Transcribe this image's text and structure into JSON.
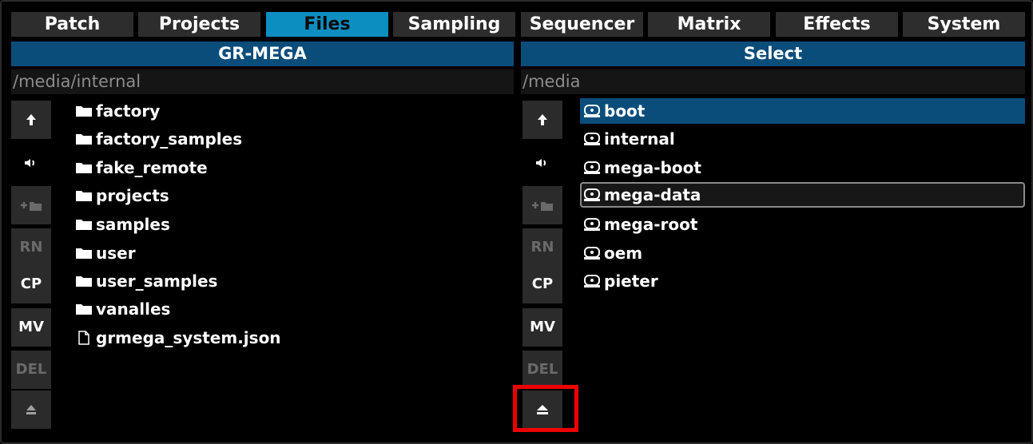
{
  "tabs": [
    {
      "label": "Patch"
    },
    {
      "label": "Projects"
    },
    {
      "label": "Files"
    },
    {
      "label": "Sampling"
    },
    {
      "label": "Sequencer"
    },
    {
      "label": "Matrix"
    },
    {
      "label": "Effects"
    },
    {
      "label": "System"
    }
  ],
  "active_tab": "Files",
  "left": {
    "header": "GR-MEGA",
    "path": "/media/internal",
    "items": [
      {
        "label": "factory",
        "icon": "folder-icon"
      },
      {
        "label": "factory_samples",
        "icon": "folder-icon"
      },
      {
        "label": "fake_remote",
        "icon": "folder-icon"
      },
      {
        "label": "projects",
        "icon": "folder-icon"
      },
      {
        "label": "samples",
        "icon": "folder-icon"
      },
      {
        "label": "user",
        "icon": "folder-icon"
      },
      {
        "label": "user_samples",
        "icon": "folder-icon"
      },
      {
        "label": "vanalles",
        "icon": "folder-icon"
      },
      {
        "label": "grmega_system.json",
        "icon": "file-icon"
      }
    ]
  },
  "right": {
    "header": "Select",
    "path": "/media",
    "selected_item": "boot",
    "focused_item": "mega-data",
    "items": [
      {
        "label": "boot",
        "icon": "drive-icon"
      },
      {
        "label": "internal",
        "icon": "drive-icon"
      },
      {
        "label": "mega-boot",
        "icon": "drive-icon"
      },
      {
        "label": "mega-data",
        "icon": "drive-icon"
      },
      {
        "label": "mega-root",
        "icon": "drive-icon"
      },
      {
        "label": "oem",
        "icon": "drive-icon"
      },
      {
        "label": "pieter",
        "icon": "drive-icon"
      }
    ]
  },
  "side_buttons": {
    "rn": "RN",
    "cp": "CP",
    "mv": "MV",
    "del": "DEL"
  },
  "colors": {
    "tab_active": "#0c8ec0",
    "header_bar": "#0a4d7b",
    "highlight_box": "#ee0000"
  }
}
